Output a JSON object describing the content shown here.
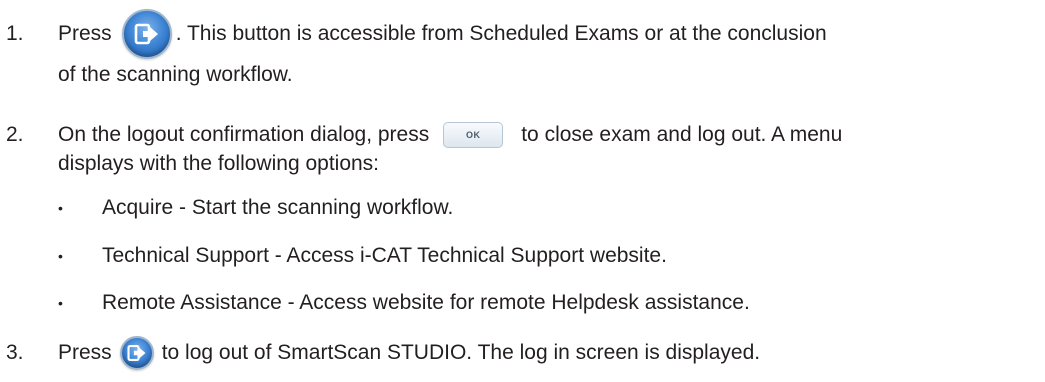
{
  "steps": [
    {
      "number": "1.",
      "before_icon": "Press",
      "icon": "logout-icon",
      "after_icon": ". This button is accessible from Scheduled Exams or at the conclusion",
      "continuation": "of the scanning workflow."
    },
    {
      "number": "2.",
      "before_button": "On the logout confirmation dialog, press",
      "button_label": "OK",
      "after_button": "to close exam and log out. A menu",
      "continuation": "displays with the following options:",
      "bullets": [
        {
          "marker": "•",
          "text": "Acquire - Start the scanning workflow."
        },
        {
          "marker": "•",
          "text": "Technical Support - Access i-CAT Technical Support website."
        },
        {
          "marker": "•",
          "text": "Remote Assistance - Access website for remote Helpdesk assistance."
        }
      ]
    },
    {
      "number": "3.",
      "before_icon": "Press",
      "icon": "logout-icon",
      "after_icon": "to log out of SmartScan STUDIO. The log in screen is displayed."
    }
  ],
  "colors": {
    "text": "#231f20",
    "icon_blue": "#3f86d6",
    "icon_border": "#9fb6cc",
    "ok_border": "#b8c6d4"
  }
}
